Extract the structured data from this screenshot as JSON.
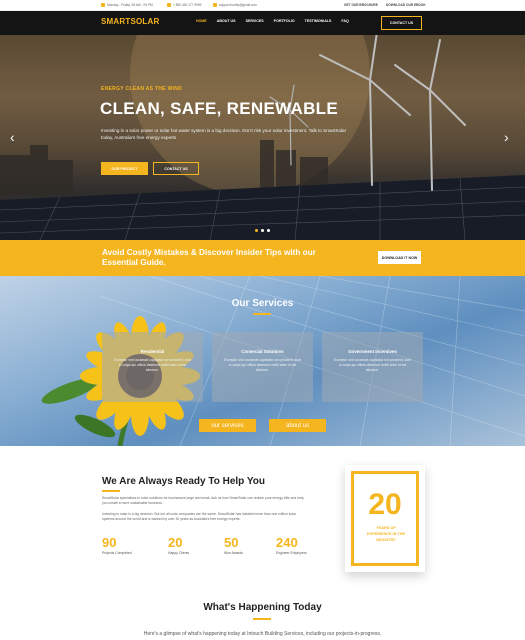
{
  "topbar": {
    "hours": "Monday - Friday, 08 AM - 05 PM",
    "phone": "+ 800 440 177 9999",
    "email": "support.budby@gmail.com",
    "brochure_link": "GET OUR BROCHURE",
    "ebook_link": "DOWNLOAD OUR EBOOK"
  },
  "header": {
    "logo": "SMARTSOLAR",
    "nav": [
      "HOME",
      "ABOUT US",
      "SERVICES",
      "PORTFOLIO",
      "TESTIMONIALS",
      "FAQ"
    ],
    "active_nav": "HOME",
    "contact_button": "CONTACT US"
  },
  "hero": {
    "eyebrow": "ENERGY CLEAN AS THE WIND",
    "title": "CLEAN, SAFE, RENEWABLE",
    "description": "Investing in a solar power or solar hot water system is a big decision. Don't risk your solar investment. Talk to SmartSolar today, Australia's free energy experts",
    "primary_button": "OUR PROJECT",
    "secondary_button": "CONTACT US",
    "prev_arrow": "‹",
    "next_arrow": "›",
    "slide_count": 3,
    "active_slide": 1
  },
  "banner": {
    "text": "Avoid Costly Mistakes & Discover Insider Tips with our Essential Guide.",
    "button": "DOWNLOAD IT NOW"
  },
  "services": {
    "title": "Our Services",
    "cards": [
      {
        "title": "Residential",
        "desc": "Exceptur sint occaecat cupidatat non proident, sunt in culpa qui officia deserunt mollit anim id est laborum."
      },
      {
        "title": "Comercial Solutions",
        "desc": "Exceptur sint occaecat cupidatat non proident, sunt in culpa qui officia deserunt mollit anim id est laborum."
      },
      {
        "title": "Government Incentives",
        "desc": "Exceptur sint occaecat cupidatat non proident, sunt in culpa qui officia deserunt mollit anim id est laborum."
      }
    ],
    "buttons": [
      "our services",
      "about us"
    ]
  },
  "about": {
    "title": "We Are Always Ready To Help You",
    "p1": "SmartSolar specialises in solar solutions for businesses large and small. Ask us how SmartSolar can reduce your energy bills and help you create a more sustainable business.",
    "p2": "Investing in solar is a big decision. But not all solar companies are the same. SmartSolar has installed more than one million solar systems around the world and is backed by over 30 years as Australia's free energy experts.",
    "stats": [
      {
        "number": "90",
        "label": "Projects Completed"
      },
      {
        "number": "20",
        "label": "Happy Clients"
      },
      {
        "number": "50",
        "label": "Won Awards"
      },
      {
        "number": "240",
        "label": "Engineer Employers"
      }
    ],
    "years_number": "20",
    "years_label": "YEARS OF EXPERIENCE IN THE INDUSTRY"
  },
  "happening": {
    "title": "What's Happening Today",
    "text": "Here's a glimpse of what's happening today at Intouch Building Services, including our projects-in-progress,"
  },
  "colors": {
    "accent": "#f5b51e",
    "header_bg": "#141414"
  }
}
